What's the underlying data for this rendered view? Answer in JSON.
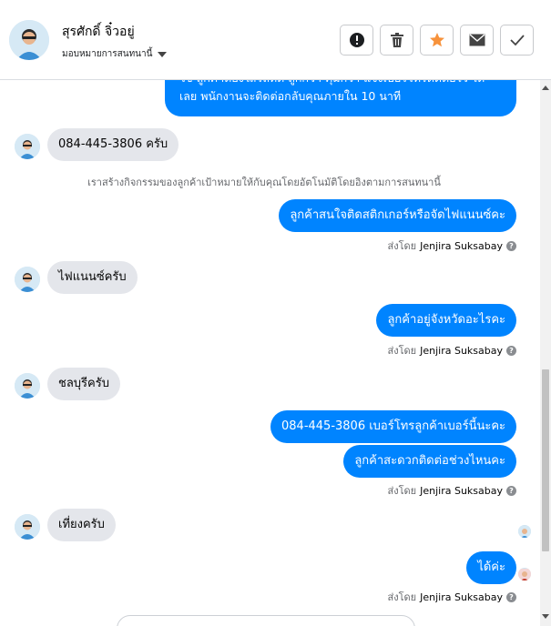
{
  "header": {
    "name": "สุรศักดิ์ จิ๋วอยู่",
    "assign_label": "มอบหมายการสนทนานี้",
    "actions": [
      "report",
      "delete",
      "star",
      "mail",
      "done"
    ]
  },
  "colors": {
    "accent": "#0084ff",
    "star": "#f7923b",
    "incoming": "#e4e6eb"
  },
  "conversation": {
    "top_partial": "ใช่ ลูกค้าต้องใส่รถที่ดี ถูกกว่า คุ้มกว่า แจ้งเบอร์โทรติดต่อไว้ ได้เลย พนักงานจะติดต่อกลับคุณภายใน 10 นาที",
    "in1": "084-445-3806 ครับ",
    "system_note": "เราสร้างกิจกรรมของลูกค้าเป้าหมายให้กับคุณโดยอัตโนมัติโดยอิงตามการสนทนานี้",
    "out1": "ลูกค้าสนใจติดสติกเกอร์หรือจัดไฟแนนซ์คะ",
    "in2": "ไฟแนนซ์ครับ",
    "out2": "ลูกค้าอยู่จังหวัดอะไรคะ",
    "in3": "ชลบุรีครับ",
    "out3a": "084-445-3806  เบอร์โทรลูกค้าเบอร์นี้นะคะ",
    "out3b": "ลูกค้าสะดวกติดต่อช่วงไหนคะ",
    "in4": "เที่ยงครับ",
    "out4": "ได้ค่ะ",
    "sent_by_label": "ส่งโดย",
    "agent": "Jenjira Suksabay",
    "help_glyph": "?"
  }
}
